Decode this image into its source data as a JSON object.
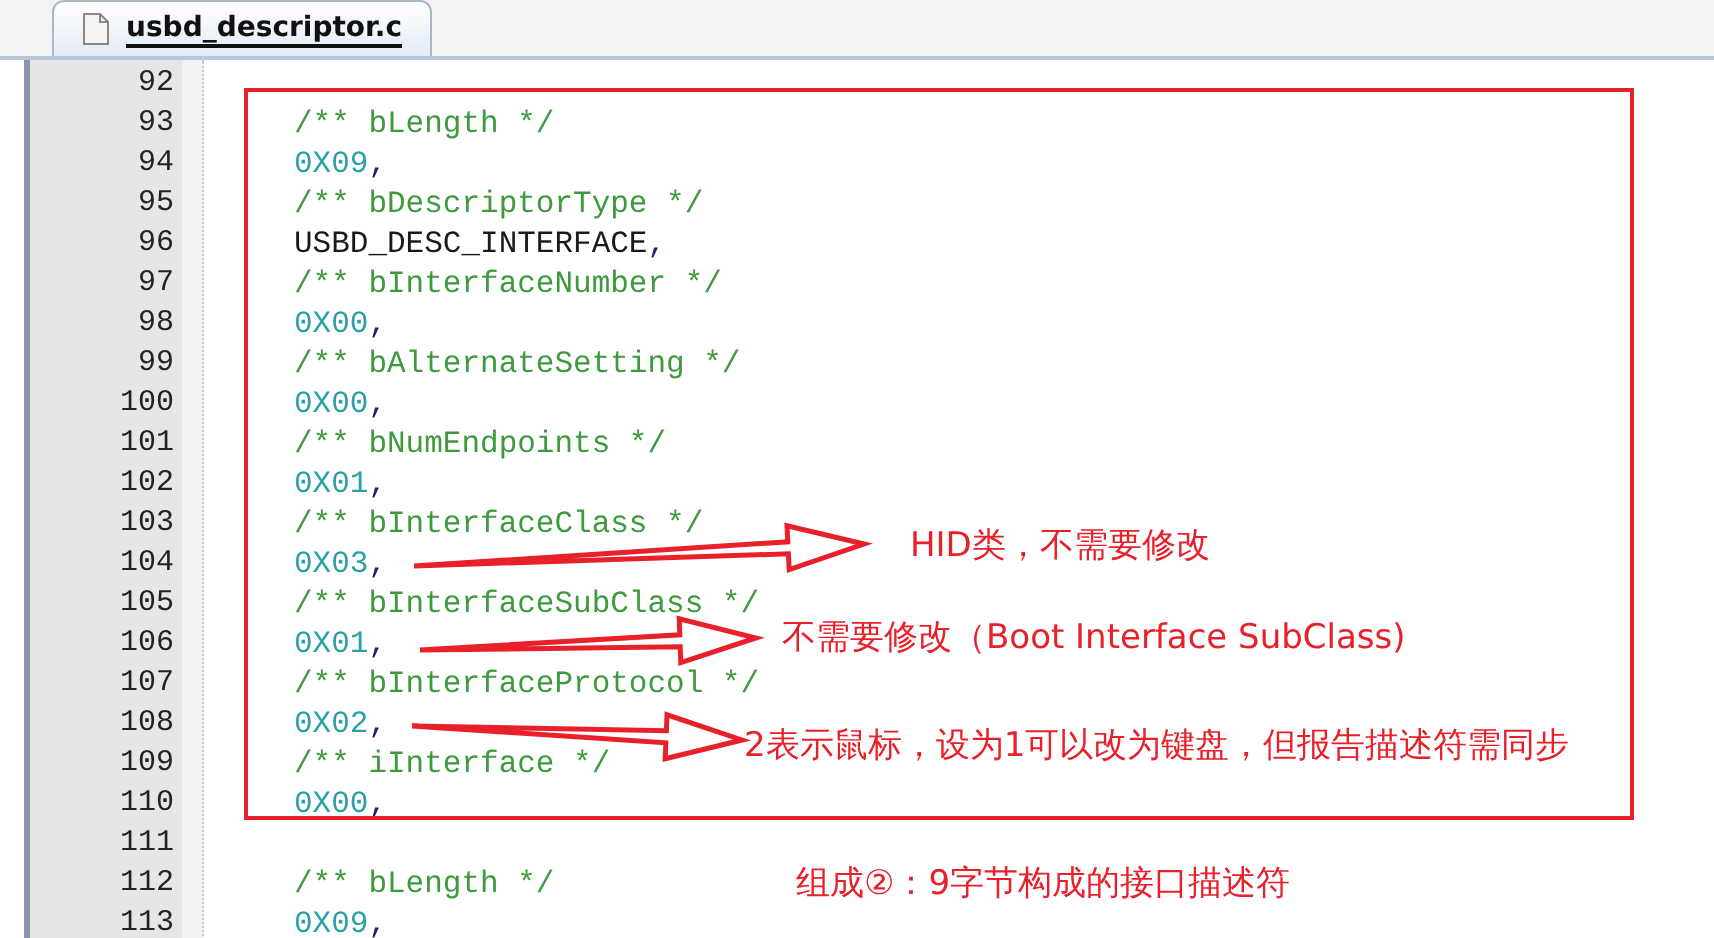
{
  "tabs": [
    {
      "label": "usbd_descriptor.c",
      "selected": true
    }
  ],
  "lines": [
    {
      "number": "92"
    },
    {
      "number": "93",
      "tokens": [
        {
          "kind": "comment",
          "text": "/** bLength */"
        }
      ]
    },
    {
      "number": "94",
      "tokens": [
        {
          "kind": "number",
          "text": "0X09"
        },
        {
          "kind": "punct",
          "text": ","
        }
      ]
    },
    {
      "number": "95",
      "tokens": [
        {
          "kind": "comment",
          "text": "/** bDescriptorType */"
        }
      ]
    },
    {
      "number": "96",
      "tokens": [
        {
          "kind": "ident",
          "text": "USBD_DESC_INTERFACE"
        },
        {
          "kind": "punct",
          "text": ","
        }
      ]
    },
    {
      "number": "97",
      "tokens": [
        {
          "kind": "comment",
          "text": "/** bInterfaceNumber */"
        }
      ]
    },
    {
      "number": "98",
      "tokens": [
        {
          "kind": "number",
          "text": "0X00"
        },
        {
          "kind": "punct",
          "text": ","
        }
      ]
    },
    {
      "number": "99",
      "tokens": [
        {
          "kind": "comment",
          "text": "/** bAlternateSetting */"
        }
      ]
    },
    {
      "number": "100",
      "tokens": [
        {
          "kind": "number",
          "text": "0X00"
        },
        {
          "kind": "punct",
          "text": ","
        }
      ]
    },
    {
      "number": "101",
      "tokens": [
        {
          "kind": "comment",
          "text": "/** bNumEndpoints */"
        }
      ]
    },
    {
      "number": "102",
      "tokens": [
        {
          "kind": "number",
          "text": "0X01"
        },
        {
          "kind": "punct",
          "text": ","
        }
      ]
    },
    {
      "number": "103",
      "tokens": [
        {
          "kind": "comment",
          "text": "/** bInterfaceClass */"
        }
      ]
    },
    {
      "number": "104",
      "tokens": [
        {
          "kind": "number",
          "text": "0X03"
        },
        {
          "kind": "punct",
          "text": ","
        }
      ]
    },
    {
      "number": "105",
      "tokens": [
        {
          "kind": "comment",
          "text": "/** bInterfaceSubClass */"
        }
      ]
    },
    {
      "number": "106",
      "tokens": [
        {
          "kind": "number",
          "text": "0X01"
        },
        {
          "kind": "punct",
          "text": ","
        }
      ]
    },
    {
      "number": "107",
      "tokens": [
        {
          "kind": "comment",
          "text": "/** bInterfaceProtocol */"
        }
      ]
    },
    {
      "number": "108",
      "tokens": [
        {
          "kind": "number",
          "text": "0X02"
        },
        {
          "kind": "punct",
          "text": ","
        }
      ]
    },
    {
      "number": "109",
      "tokens": [
        {
          "kind": "comment",
          "text": "/** iInterface */"
        }
      ]
    },
    {
      "number": "110",
      "tokens": [
        {
          "kind": "number",
          "text": "0X00"
        },
        {
          "kind": "punct",
          "text": ","
        }
      ]
    },
    {
      "number": "111"
    },
    {
      "number": "112",
      "tokens": [
        {
          "kind": "comment",
          "text": "/** bLength */"
        }
      ]
    },
    {
      "number": "113",
      "tokens": [
        {
          "kind": "number",
          "text": "0X09"
        },
        {
          "kind": "punct",
          "text": ","
        }
      ]
    }
  ],
  "annotations": [
    {
      "text": "HID类，不需要修改"
    },
    {
      "text": "不需要修改（Boot Interface SubClass)"
    },
    {
      "text": "2表示鼠标，设为1可以改为键盘，但报告描述符需同步"
    },
    {
      "text": "组成②：9字节构成的接口描述符"
    }
  ]
}
